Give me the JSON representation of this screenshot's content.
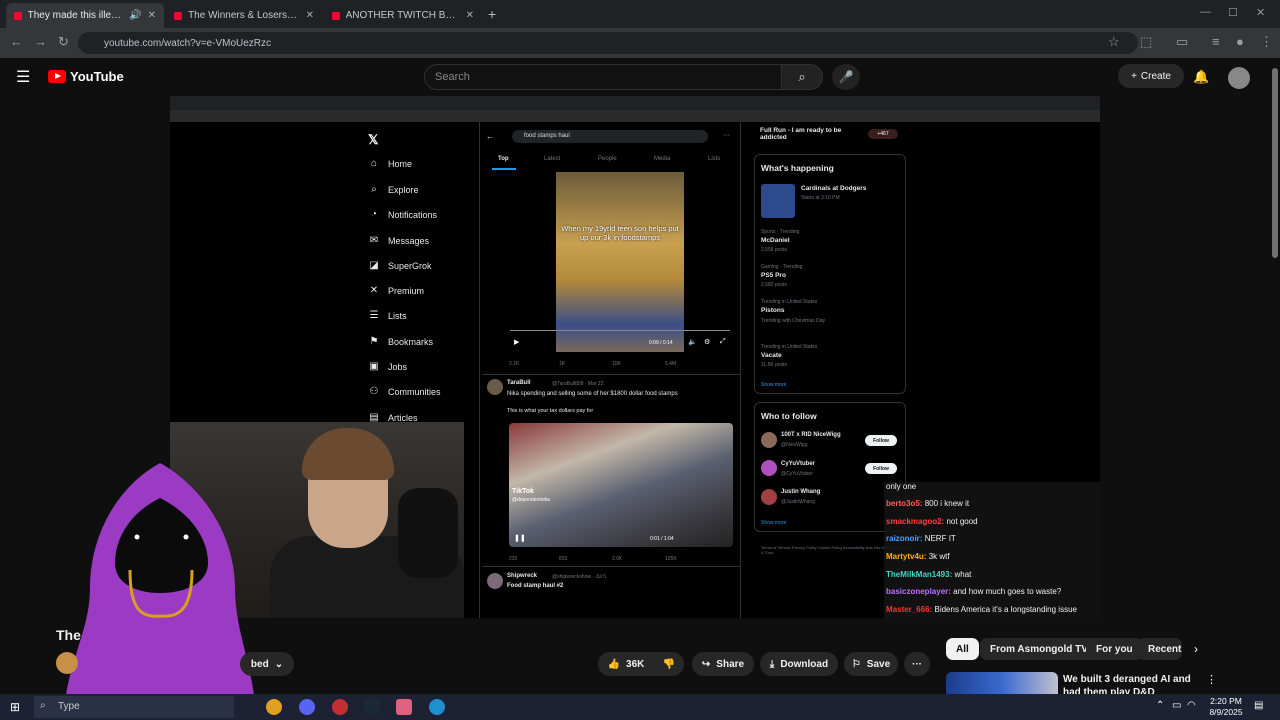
{
  "browser": {
    "tabs": [
      {
        "title": "They made this illegal... - Yo",
        "active": true
      },
      {
        "title": "The Winners & Losers of Patch",
        "active": false
      },
      {
        "title": "ANOTHER TWITCH BAN??? - Yo",
        "active": false
      }
    ],
    "new_tab": "+",
    "url": "youtube.com/watch?v=e-VMoUezRzc"
  },
  "youtube": {
    "logo": "YouTube",
    "search_placeholder": "Search",
    "create": "Create",
    "title_partial": "The",
    "subscribed": "bed",
    "likes": "36K",
    "share": "Share",
    "download": "Download",
    "save": "Save",
    "chips": [
      "All",
      "From Asmongold TV",
      "For you",
      "Recent"
    ],
    "rec_title": "We built 3 deranged AI and had them play D&D"
  },
  "x": {
    "nav": [
      "Home",
      "Explore",
      "Notifications",
      "Messages",
      "SuperGrok",
      "Premium",
      "Lists",
      "Bookmarks",
      "Jobs",
      "Communities",
      "Articles"
    ],
    "search_query": "food stamps haul",
    "tabs": [
      "Top",
      "Latest",
      "People",
      "Media",
      "Lists"
    ],
    "video1_caption": "When my 19yrld teen son helps put up our 3k in foodstamps",
    "video1_time": "0:09 / 0:14",
    "video1_stats": [
      "2.1K",
      "1K",
      "10K",
      "5.4M"
    ],
    "tweet2": {
      "name": "TaraBull",
      "handle": "@TaraBull808 · Mar 22",
      "text": "Nika spending and selling some of her $1800 dollar food stamps",
      "subtext": "This is what your tax dollars pay for",
      "tiktok": "TikTok",
      "tiktok_handle": "@dependentnika",
      "time": "0:01 / 1:04",
      "stats": [
        "220",
        "833",
        "2.0K",
        "125K"
      ]
    },
    "tweet3": {
      "name": "Shipwreck",
      "handle": "@shipwreckshow · Jul 5",
      "text": "Food stamp haul #2"
    },
    "right": {
      "top_item": "Full Run - I am ready to be addicted",
      "top_badge": "+467",
      "happening_title": "What's happening",
      "event": "Cardinals at Dodgers",
      "event_sub": "Starts at 3:10 PM",
      "trends": [
        {
          "ctx": "Sports · Trending",
          "name": "McDaniel",
          "posts": "2,558 posts"
        },
        {
          "ctx": "Gaming · Trending",
          "name": "PS5 Pro",
          "posts": "2,582 posts"
        },
        {
          "ctx": "Trending in United States",
          "name": "Pistons",
          "posts": "Trending with Christmas Day"
        },
        {
          "ctx": "Trending in United States",
          "name": "Vacate",
          "posts": "11.5K posts"
        }
      ],
      "show_more": "Show more",
      "who_title": "Who to follow",
      "follow": [
        {
          "name": "100T x RID NiceWigg",
          "handle": "@NiceWigg"
        },
        {
          "name": "CyYuVtuber",
          "handle": "@CyYuVtuber"
        },
        {
          "name": "Justin Whang",
          "handle": "@JustinWhang"
        }
      ],
      "follow_label": "Follow",
      "footer": "Terms of Service  Privacy Policy  Cookie Policy  Accessibility  Ads info  More ··· © 2025 X Corp."
    }
  },
  "chat": [
    {
      "user": "",
      "msg": "only one",
      "color": "#ffffff"
    },
    {
      "user": "berto3o5:",
      "msg": "800 i knew it",
      "color": "#ff6060"
    },
    {
      "user": "smackmagoo2:",
      "msg": "not good",
      "color": "#ff4040"
    },
    {
      "user": "raizonoir:",
      "msg": "NERF IT",
      "color": "#4aa0ff"
    },
    {
      "user": "Martytv4u:",
      "msg": "3k wtf",
      "color": "#ffb000"
    },
    {
      "user": "TheMilkMan1493:",
      "msg": "what",
      "color": "#40d8c8"
    },
    {
      "user": "basiczoneplayer:",
      "msg": "and how much goes to waste?",
      "color": "#c070ff"
    },
    {
      "user": "Master_666:",
      "msg": "Bidens America it's a longstanding issue",
      "color": "#ff3030"
    }
  ],
  "taskbar": {
    "search": "Type",
    "time": "2:20 PM",
    "date": "8/9/2025"
  }
}
